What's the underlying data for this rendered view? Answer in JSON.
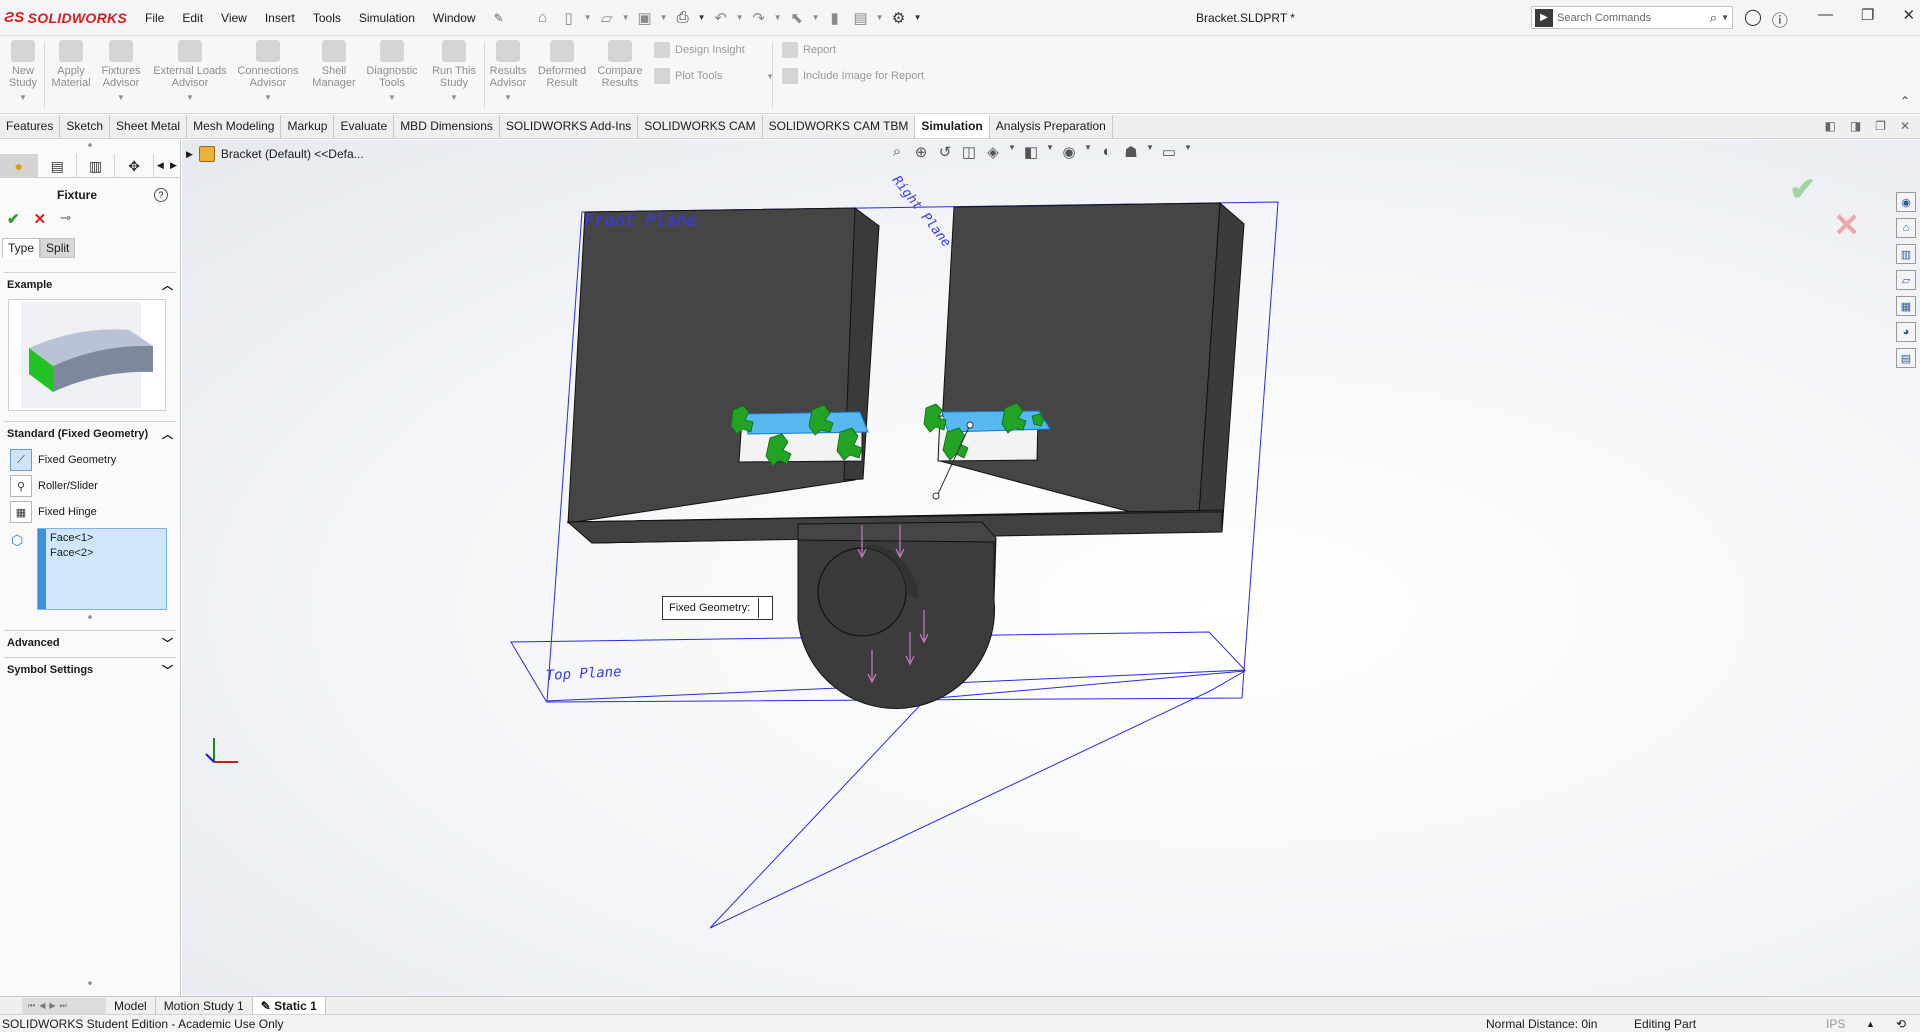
{
  "app": {
    "logo_text": "SOLIDWORKS",
    "document_title": "Bracket.SLDPRT *",
    "menu": [
      "File",
      "Edit",
      "View",
      "Insert",
      "Tools",
      "Simulation",
      "Window"
    ],
    "search_placeholder": "Search Commands"
  },
  "commands": {
    "new_study": "New Study",
    "apply_material": "Apply Material",
    "fixtures_advisor": "Fixtures Advisor",
    "external_loads_advisor": "External Loads Advisor",
    "connections_advisor": "Connections Advisor",
    "shell_manager": "Shell Manager",
    "diagnostic_tools": "Diagnostic Tools",
    "run_this_study": "Run This Study",
    "results_advisor": "Results Advisor",
    "deformed_result": "Deformed Result",
    "compare_results": "Compare Results",
    "design_insight": "Design Insight",
    "plot_tools": "Plot Tools",
    "report": "Report",
    "include_image_for_report": "Include Image for Report"
  },
  "tabs": [
    {
      "label": "Features",
      "active": false
    },
    {
      "label": "Sketch",
      "active": false
    },
    {
      "label": "Sheet Metal",
      "active": false
    },
    {
      "label": "Mesh Modeling",
      "active": false
    },
    {
      "label": "Markup",
      "active": false
    },
    {
      "label": "Evaluate",
      "active": false
    },
    {
      "label": "MBD Dimensions",
      "active": false
    },
    {
      "label": "SOLIDWORKS Add-Ins",
      "active": false
    },
    {
      "label": "SOLIDWORKS CAM",
      "active": false
    },
    {
      "label": "SOLIDWORKS CAM TBM",
      "active": false
    },
    {
      "label": "Simulation",
      "active": true
    },
    {
      "label": "Analysis Preparation",
      "active": false
    }
  ],
  "property_manager": {
    "title": "Fixture",
    "subtabs": {
      "type": "Type",
      "split": "Split"
    },
    "example_header": "Example",
    "standard_header": "Standard (Fixed Geometry)",
    "options": {
      "fixed_geometry": "Fixed Geometry",
      "roller_slider": "Roller/Slider",
      "fixed_hinge": "Fixed Hinge"
    },
    "selected_faces": [
      "Face<1>",
      "Face<2>"
    ],
    "advanced_header": "Advanced",
    "symbol_settings_header": "Symbol Settings"
  },
  "viewport": {
    "tree_item": "Bracket (Default) <<Defa...",
    "planes": {
      "front": "Front Plane",
      "right": "Right Plane",
      "top": "Top Plane"
    },
    "callout": "Fixed Geometry:",
    "colors": {
      "part": "#454545",
      "plane": "#2a2ae0",
      "fixture_face": "#58b8f0",
      "fixture_symbol": "#23a323",
      "load_arrow": "#c97ac9"
    }
  },
  "bottom_tabs": [
    {
      "label": "Model",
      "active": false
    },
    {
      "label": "Motion Study 1",
      "active": false
    },
    {
      "label": "Static 1",
      "active": true
    }
  ],
  "status": {
    "edition": "SOLIDWORKS Student Edition - Academic Use Only",
    "normal_distance": "Normal Distance: 0in",
    "editing": "Editing Part",
    "units": "IPS"
  }
}
